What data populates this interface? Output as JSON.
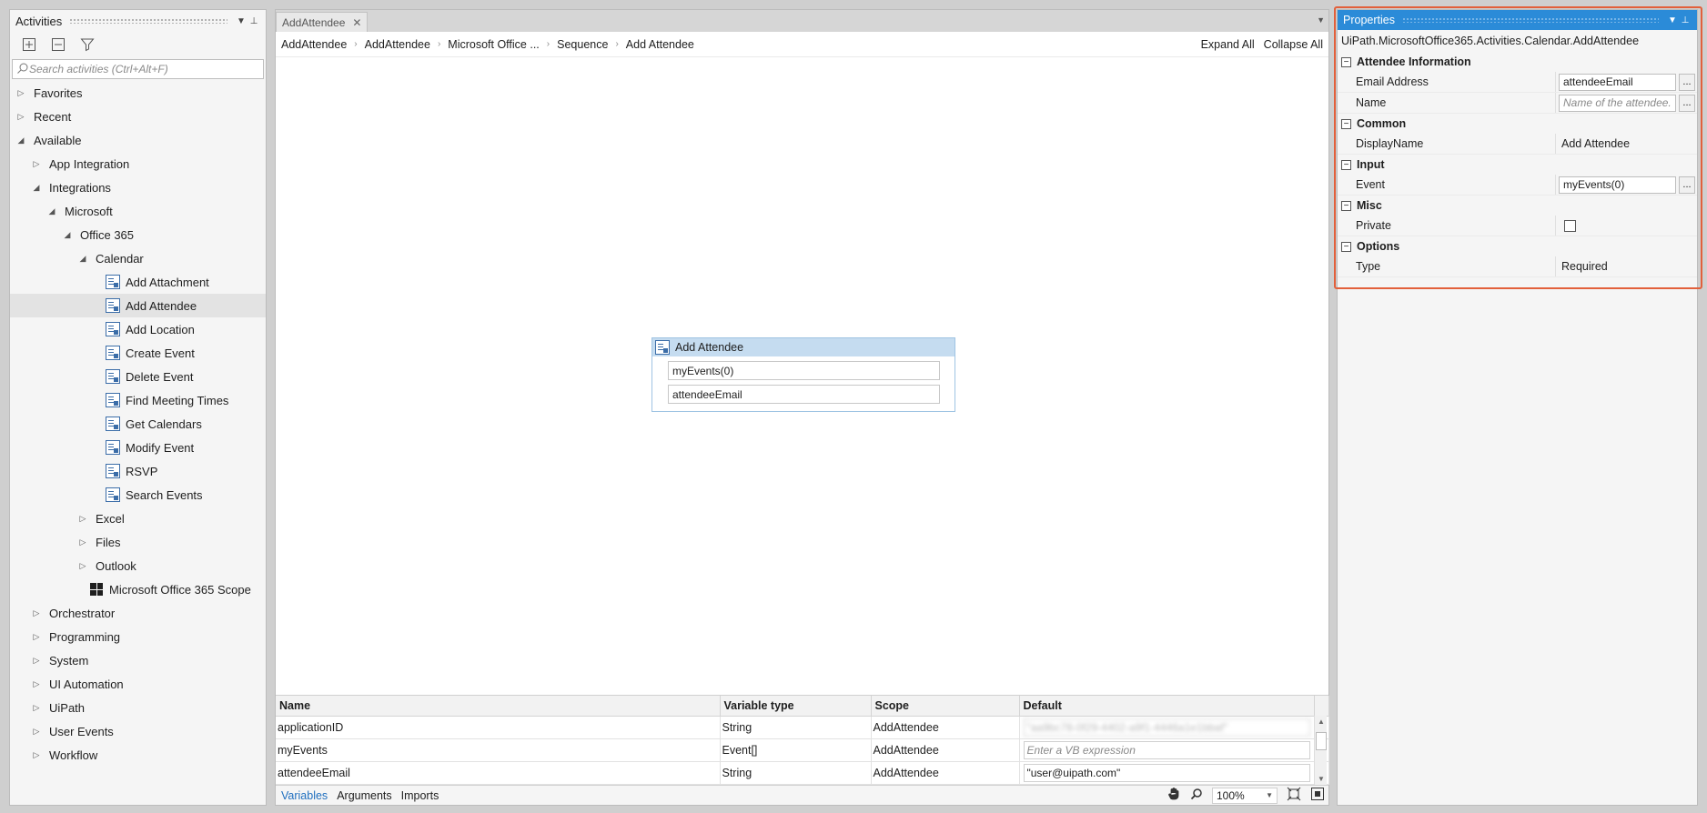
{
  "activities": {
    "title": "Activities",
    "search_placeholder": "Search activities (Ctrl+Alt+F)",
    "tree": [
      {
        "label": "Favorites",
        "level": 0,
        "expanded": false,
        "kind": "folder"
      },
      {
        "label": "Recent",
        "level": 0,
        "expanded": false,
        "kind": "folder"
      },
      {
        "label": "Available",
        "level": 0,
        "expanded": true,
        "kind": "folder"
      },
      {
        "label": "App Integration",
        "level": 1,
        "expanded": false,
        "kind": "folder"
      },
      {
        "label": "Integrations",
        "level": 1,
        "expanded": true,
        "kind": "folder"
      },
      {
        "label": "Microsoft",
        "level": 2,
        "expanded": true,
        "kind": "folder"
      },
      {
        "label": "Office 365",
        "level": 3,
        "expanded": true,
        "kind": "folder"
      },
      {
        "label": "Calendar",
        "level": 4,
        "expanded": true,
        "kind": "folder"
      },
      {
        "label": "Add Attachment",
        "level": 5,
        "kind": "activity"
      },
      {
        "label": "Add Attendee",
        "level": 5,
        "kind": "activity",
        "selected": true
      },
      {
        "label": "Add Location",
        "level": 5,
        "kind": "activity"
      },
      {
        "label": "Create Event",
        "level": 5,
        "kind": "activity"
      },
      {
        "label": "Delete Event",
        "level": 5,
        "kind": "activity"
      },
      {
        "label": "Find Meeting Times",
        "level": 5,
        "kind": "activity"
      },
      {
        "label": "Get Calendars",
        "level": 5,
        "kind": "activity"
      },
      {
        "label": "Modify Event",
        "level": 5,
        "kind": "activity"
      },
      {
        "label": "RSVP",
        "level": 5,
        "kind": "activity"
      },
      {
        "label": "Search Events",
        "level": 5,
        "kind": "activity"
      },
      {
        "label": "Excel",
        "level": 4,
        "expanded": false,
        "kind": "folder"
      },
      {
        "label": "Files",
        "level": 4,
        "expanded": false,
        "kind": "folder"
      },
      {
        "label": "Outlook",
        "level": 4,
        "expanded": false,
        "kind": "folder"
      },
      {
        "label": "Microsoft Office 365 Scope",
        "level": 4,
        "kind": "scope"
      },
      {
        "label": "Orchestrator",
        "level": 1,
        "expanded": false,
        "kind": "folder"
      },
      {
        "label": "Programming",
        "level": 1,
        "expanded": false,
        "kind": "folder"
      },
      {
        "label": "System",
        "level": 1,
        "expanded": false,
        "kind": "folder"
      },
      {
        "label": "UI Automation",
        "level": 1,
        "expanded": false,
        "kind": "folder"
      },
      {
        "label": "UiPath",
        "level": 1,
        "expanded": false,
        "kind": "folder"
      },
      {
        "label": "User Events",
        "level": 1,
        "expanded": false,
        "kind": "folder"
      },
      {
        "label": "Workflow",
        "level": 1,
        "expanded": false,
        "kind": "folder"
      }
    ]
  },
  "designer": {
    "tab_label": "AddAttendee",
    "breadcrumbs": [
      "AddAttendee",
      "AddAttendee",
      "Microsoft Office ...",
      "Sequence",
      "Add Attendee"
    ],
    "expand_all": "Expand All",
    "collapse_all": "Collapse All",
    "activity": {
      "title": "Add Attendee",
      "field_event": "myEvents(0)",
      "field_email": "attendeeEmail"
    },
    "variables": {
      "columns": [
        "Name",
        "Variable type",
        "Scope",
        "Default"
      ],
      "rows": [
        {
          "name": "applicationID",
          "type": "String",
          "scope": "AddAttendee",
          "default": "\"aa9bc78-0f29-4402-a9f1-4446a1e1bbaf\"",
          "default_style": "blur"
        },
        {
          "name": "myEvents",
          "type": "Event[]",
          "scope": "AddAttendee",
          "default": "Enter a VB expression",
          "default_style": "ph"
        },
        {
          "name": "attendeeEmail",
          "type": "String",
          "scope": "AddAttendee",
          "default": "\"user@uipath.com\"",
          "default_style": "normal"
        }
      ]
    },
    "bottom_tabs": [
      "Variables",
      "Arguments",
      "Imports"
    ],
    "zoom": "100%"
  },
  "properties": {
    "title": "Properties",
    "type_name": "UiPath.MicrosoftOffice365.Activities.Calendar.AddAttendee",
    "categories": [
      {
        "name": "Attendee Information",
        "rows": [
          {
            "label": "Email Address",
            "value": "attendeeEmail",
            "kind": "input"
          },
          {
            "label": "Name",
            "value": "Name of the attendee.",
            "kind": "input-placeholder"
          }
        ]
      },
      {
        "name": "Common",
        "rows": [
          {
            "label": "DisplayName",
            "value": "Add Attendee",
            "kind": "text"
          }
        ]
      },
      {
        "name": "Input",
        "rows": [
          {
            "label": "Event",
            "value": "myEvents(0)",
            "kind": "input"
          }
        ]
      },
      {
        "name": "Misc",
        "rows": [
          {
            "label": "Private",
            "value": "",
            "kind": "checkbox"
          }
        ]
      },
      {
        "name": "Options",
        "rows": [
          {
            "label": "Type",
            "value": "Required",
            "kind": "text"
          }
        ]
      }
    ],
    "dots_label": "..."
  },
  "colors": {
    "properties_header": "#2b8bd8",
    "highlight": "#e2603b",
    "activity_title_bg": "#c5dcf0"
  }
}
